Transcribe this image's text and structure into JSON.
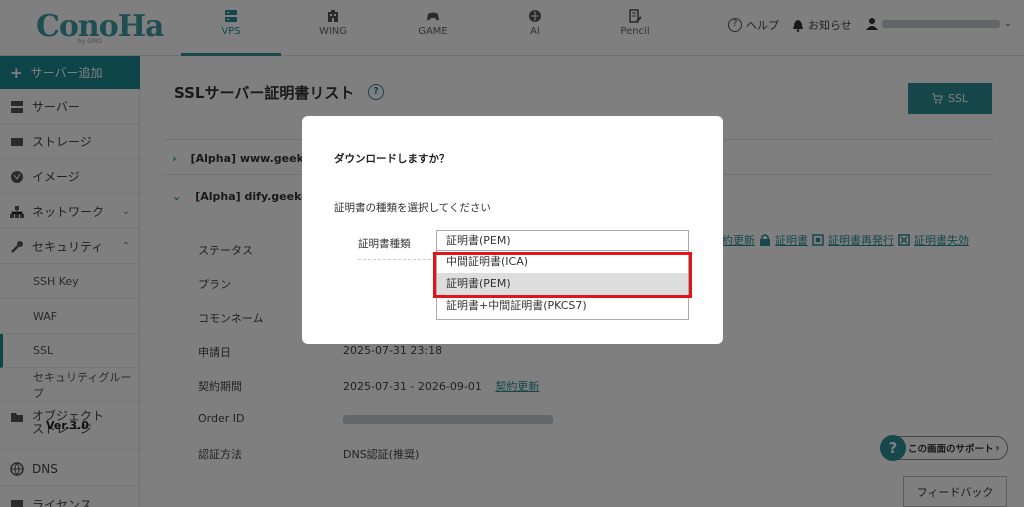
{
  "header": {
    "logo": "ConoHa",
    "logo_sub": "by GMO",
    "nav": [
      {
        "label": "VPS",
        "icon": "server-icon"
      },
      {
        "label": "WING",
        "icon": "building-icon"
      },
      {
        "label": "GAME",
        "icon": "gamepad-icon"
      },
      {
        "label": "AI",
        "icon": "brain-icon"
      },
      {
        "label": "Pencil",
        "icon": "document-pen-icon"
      }
    ],
    "help": "ヘルプ",
    "notifications": "お知らせ"
  },
  "sidebar": {
    "add_server": "サーバー追加",
    "items": [
      {
        "label": "サーバー"
      },
      {
        "label": "ストレージ"
      },
      {
        "label": "イメージ"
      },
      {
        "label": "ネットワーク"
      },
      {
        "label": "セキュリティ"
      }
    ],
    "sub_items": [
      {
        "label": "SSH Key"
      },
      {
        "label": "WAF"
      },
      {
        "label": "SSL"
      },
      {
        "label": "セキュリティグループ"
      }
    ],
    "object_storage": "オブジェクトストレージ",
    "version": "Ver.3.0",
    "dns": "DNS",
    "license": "ライセンス"
  },
  "main": {
    "title": "SSLサーバー証明書リスト",
    "ssl_button": "SSL",
    "cert_rows": [
      {
        "chevron": "›",
        "name": "[Alpha] www.geek"
      },
      {
        "chevron": "⌄",
        "name": "[Alpha] dify.geekov"
      }
    ],
    "details": [
      {
        "label": "ステータス",
        "value": ""
      },
      {
        "label": "プラン",
        "value": ""
      },
      {
        "label": "コモンネーム",
        "value": ""
      },
      {
        "label": "申請日",
        "value": "2025-07-31 23:18"
      },
      {
        "label": "契約期間",
        "value": "2025-07-31 - 2026-09-01"
      },
      {
        "label": "Order ID",
        "value": ""
      },
      {
        "label": "認証方法",
        "value": "DNS認証(推奨)"
      }
    ],
    "renew_link": "契約更新",
    "actions": [
      "約更新",
      "証明書",
      "証明書再発行",
      "証明書失効"
    ],
    "support": "この画面のサポート",
    "feedback": "フィードバック"
  },
  "modal": {
    "title": "ダウンロードしますか？",
    "subtitle": "証明書の種類を選択してください",
    "label": "証明書種類",
    "selected": "証明書(PEM)",
    "options": [
      "中間証明書(ICA)",
      "証明書(PEM)",
      "証明書+中間証明書(PKCS7)"
    ]
  },
  "colors": {
    "accent": "#2a8e97",
    "highlight_border": "#e0141c"
  }
}
